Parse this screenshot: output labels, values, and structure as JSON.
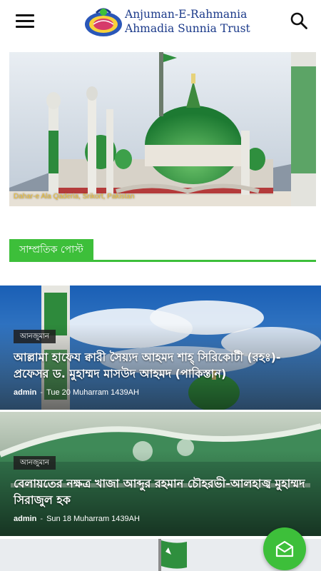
{
  "header": {
    "logo_line1": "Anjuman-E-Rahmania",
    "logo_line2": "Ahmadia Sunnia Trust",
    "menu_icon": "hamburger-menu-icon",
    "search_icon": "search-icon"
  },
  "hero": {
    "caption": "Dahar-e Ala Qaderia, Srikort, Pakistan"
  },
  "section": {
    "title": "সাম্প্রতিক পোস্ট"
  },
  "posts": [
    {
      "category": "আনজুমান",
      "title": "আল্লামা হাফেয ক্বারী সৈয়্যদ আহমদ শাহ্ সিরিকোটী (রহঃ)- প্রফেসর ড. মুহাম্মদ মাসউদ আহমদ (পাকিস্তান)",
      "author": "admin",
      "separator": "-",
      "date": "Tue 20 Muharram 1439AH"
    },
    {
      "category": "আনজুমান",
      "title": "বেলায়তের নক্ষত্র খাজা আব্দুর রহমান চৌহরভী-আলহাজ্ব মুহাম্মদ সিরাজুল হক",
      "author": "admin",
      "separator": "-",
      "date": "Sun 18 Muharram 1439AH"
    }
  ],
  "fab": {
    "icon": "mail-envelope-icon"
  },
  "colors": {
    "accent": "#3dbf3a",
    "logo_text": "#1b3a8a"
  }
}
